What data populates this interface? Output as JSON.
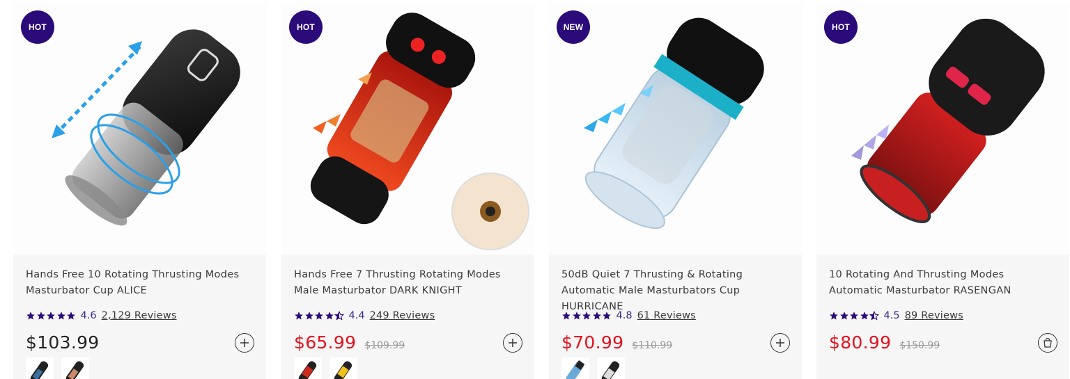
{
  "products": [
    {
      "badge": "HOT",
      "title": "Hands Free 10 Rotating Thrusting Modes Masturbator Cup ALICE",
      "rating": "4.6",
      "reviews": "2,129 Reviews",
      "price": "$103.99",
      "compare_price": "",
      "on_sale": false,
      "action_icon": "plus-icon",
      "image_desc": "black-masturbator-alice",
      "swatch_colors": [
        "#3a6fa0",
        "#c98a6a"
      ]
    },
    {
      "badge": "HOT",
      "title": "Hands Free 7 Thrusting Rotating Modes Male Masturbator DARK KNIGHT",
      "rating": "4.4",
      "reviews": "249 Reviews",
      "price": "$65.99",
      "compare_price": "$109.99",
      "on_sale": true,
      "action_icon": "plus-icon",
      "image_desc": "red-black-masturbator-dark-knight",
      "swatch_colors": [
        "#d02a1e",
        "#f0c21a"
      ]
    },
    {
      "badge": "NEW",
      "title": "50dB Quiet 7 Thrusting & Rotating Automatic Male Masturbators Cup HURRICANE",
      "rating": "4.8",
      "reviews": "61 Reviews",
      "price": "$70.99",
      "compare_price": "$110.99",
      "on_sale": true,
      "action_icon": "plus-icon",
      "image_desc": "clear-blue-masturbator-hurricane",
      "swatch_colors": [
        "#6aaad8",
        "#222222"
      ]
    },
    {
      "badge": "HOT",
      "title": "10 Rotating And Thrusting Modes Automatic Masturbator RASENGAN",
      "rating": "4.5",
      "reviews": "89 Reviews",
      "price": "$80.99",
      "compare_price": "$150.99",
      "on_sale": true,
      "action_icon": "shopping-bag-icon",
      "image_desc": "black-red-masturbator-rasengan",
      "swatch_colors": []
    }
  ],
  "colors": {
    "badge_bg": "#2b0a7a",
    "star": "#2b0a7a",
    "sale_price": "#e5121e",
    "compare_price": "#999999"
  }
}
